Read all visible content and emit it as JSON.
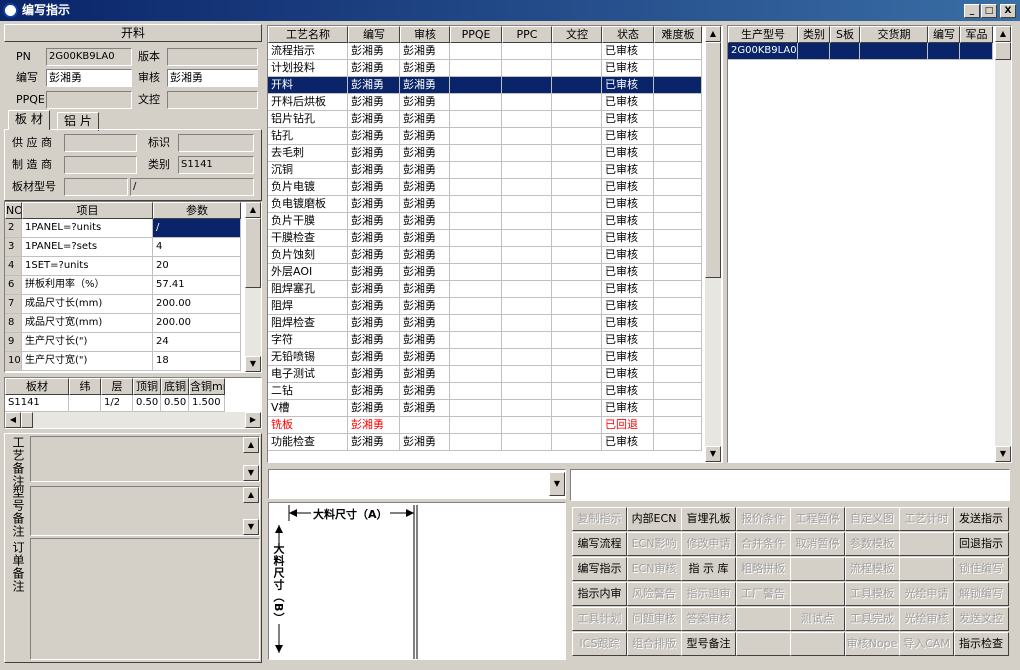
{
  "window": {
    "title": "编写指示",
    "min": "_",
    "max": "□",
    "close": "X"
  },
  "left": {
    "section_title": "开料",
    "pn_label": "PN",
    "pn_value": "2G00KB9LA0",
    "version_label": "版本",
    "version_value": "",
    "author_label": "编写",
    "author_value": "彭湘勇",
    "review_label": "审核",
    "review_value": "彭湘勇",
    "ppqe_label": "PPQE",
    "ppqe_value": "",
    "doc_label": "文控",
    "doc_value": "",
    "tabs": [
      "板 材",
      "铝 片"
    ],
    "supplier_label": "供 应 商",
    "supplier_value": "",
    "mark_label": "标识",
    "mark_value": "",
    "maker_label": "制 造 商",
    "maker_value": "",
    "category_label": "类别",
    "category_value": "S1141",
    "model_label": "板材型号",
    "model_value": "",
    "model_value2": "/",
    "param_headers": [
      "NO",
      "项目",
      "参数"
    ],
    "params": [
      {
        "no": "2",
        "item": "1PANEL=?units",
        "val": "/"
      },
      {
        "no": "3",
        "item": "1PANEL=?sets",
        "val": "4"
      },
      {
        "no": "4",
        "item": "1SET=?units",
        "val": "20"
      },
      {
        "no": "6",
        "item": "拼板利用率（%）",
        "val": "57.41"
      },
      {
        "no": "7",
        "item": "成品尺寸长(mm)",
        "val": "200.00"
      },
      {
        "no": "8",
        "item": "成品尺寸宽(mm)",
        "val": "200.00"
      },
      {
        "no": "9",
        "item": "生产尺寸长(\")",
        "val": "24"
      },
      {
        "no": "10",
        "item": "生产尺寸宽(\")",
        "val": "18"
      }
    ],
    "board_headers": [
      "板材",
      "纬",
      "层",
      "顶铜",
      "底铜",
      "含铜mm"
    ],
    "board_row": [
      "S1141",
      "",
      "1/2",
      "0.50",
      "0.50",
      "1.500"
    ],
    "notes_labels": [
      "工艺备注",
      "型号备注",
      "订单备注"
    ]
  },
  "process": {
    "headers": [
      "工艺名称",
      "编写",
      "审核",
      "PPQE",
      "PPC",
      "文控",
      "状态",
      "难度板"
    ],
    "rows": [
      [
        "流程指示",
        "彭湘勇",
        "彭湘勇",
        "",
        "",
        "",
        "已审核",
        ""
      ],
      [
        "计划投料",
        "彭湘勇",
        "彭湘勇",
        "",
        "",
        "",
        "已审核",
        ""
      ],
      [
        "开料",
        "彭湘勇",
        "彭湘勇",
        "",
        "",
        "",
        "已审核",
        ""
      ],
      [
        "开料后烘板",
        "彭湘勇",
        "彭湘勇",
        "",
        "",
        "",
        "已审核",
        ""
      ],
      [
        "铝片钻孔",
        "彭湘勇",
        "彭湘勇",
        "",
        "",
        "",
        "已审核",
        ""
      ],
      [
        "钻孔",
        "彭湘勇",
        "彭湘勇",
        "",
        "",
        "",
        "已审核",
        ""
      ],
      [
        "去毛刺",
        "彭湘勇",
        "彭湘勇",
        "",
        "",
        "",
        "已审核",
        ""
      ],
      [
        "沉铜",
        "彭湘勇",
        "彭湘勇",
        "",
        "",
        "",
        "已审核",
        ""
      ],
      [
        "负片电镀",
        "彭湘勇",
        "彭湘勇",
        "",
        "",
        "",
        "已审核",
        ""
      ],
      [
        "负电镀磨板",
        "彭湘勇",
        "彭湘勇",
        "",
        "",
        "",
        "已审核",
        ""
      ],
      [
        "负片干膜",
        "彭湘勇",
        "彭湘勇",
        "",
        "",
        "",
        "已审核",
        ""
      ],
      [
        "干膜检查",
        "彭湘勇",
        "彭湘勇",
        "",
        "",
        "",
        "已审核",
        ""
      ],
      [
        "负片蚀刻",
        "彭湘勇",
        "彭湘勇",
        "",
        "",
        "",
        "已审核",
        ""
      ],
      [
        "外层AOI",
        "彭湘勇",
        "彭湘勇",
        "",
        "",
        "",
        "已审核",
        ""
      ],
      [
        "阻焊塞孔",
        "彭湘勇",
        "彭湘勇",
        "",
        "",
        "",
        "已审核",
        ""
      ],
      [
        "阻焊",
        "彭湘勇",
        "彭湘勇",
        "",
        "",
        "",
        "已审核",
        ""
      ],
      [
        "阻焊检查",
        "彭湘勇",
        "彭湘勇",
        "",
        "",
        "",
        "已审核",
        ""
      ],
      [
        "字符",
        "彭湘勇",
        "彭湘勇",
        "",
        "",
        "",
        "已审核",
        ""
      ],
      [
        "无铅喷锡",
        "彭湘勇",
        "彭湘勇",
        "",
        "",
        "",
        "已审核",
        ""
      ],
      [
        "电子测试",
        "彭湘勇",
        "彭湘勇",
        "",
        "",
        "",
        "已审核",
        ""
      ],
      [
        "二钻",
        "彭湘勇",
        "彭湘勇",
        "",
        "",
        "",
        "已审核",
        ""
      ],
      [
        "V槽",
        "彭湘勇",
        "彭湘勇",
        "",
        "",
        "",
        "已审核",
        ""
      ],
      [
        "铣板",
        "彭湘勇",
        "",
        "",
        "",
        "",
        "已回退",
        ""
      ],
      [
        "功能检查",
        "彭湘勇",
        "彭湘勇",
        "",
        "",
        "",
        "已审核",
        ""
      ]
    ],
    "selected_index": 2,
    "returned_index": 22
  },
  "product": {
    "headers": [
      "生产型号",
      "类别",
      "S板",
      "交货期",
      "编写",
      "军品"
    ],
    "rows": [
      [
        "2G00KB9LA0",
        "",
        "",
        "",
        "",
        ""
      ]
    ]
  },
  "drawing": {
    "width_label": "大料尺寸（A）",
    "height_label": "大料尺寸（B）"
  },
  "actions": [
    [
      {
        "t": "复制指示",
        "d": true
      },
      {
        "t": "内部ECN",
        "d": false
      },
      {
        "t": "盲埋孔板",
        "d": false
      },
      {
        "t": "报价条件",
        "d": true
      },
      {
        "t": "工程暂停",
        "d": true
      },
      {
        "t": "自定义图",
        "d": true
      },
      {
        "t": "工艺计时",
        "d": true
      },
      {
        "t": "发送指示",
        "d": false
      }
    ],
    [
      {
        "t": "编写流程",
        "d": false
      },
      {
        "t": "ECN影响",
        "d": true
      },
      {
        "t": "修改申请",
        "d": true
      },
      {
        "t": "合并条件",
        "d": true
      },
      {
        "t": "取消暂停",
        "d": true
      },
      {
        "t": "参数模板",
        "d": true
      },
      {
        "t": "",
        "d": true
      },
      {
        "t": "回退指示",
        "d": false
      }
    ],
    [
      {
        "t": "编写指示",
        "d": false
      },
      {
        "t": "ECN审核",
        "d": true
      },
      {
        "t": "指 示 库",
        "d": false
      },
      {
        "t": "粗略拼板",
        "d": true
      },
      {
        "t": "",
        "d": true
      },
      {
        "t": "流程模板",
        "d": true
      },
      {
        "t": "",
        "d": true
      },
      {
        "t": "锁住编写",
        "d": true
      }
    ],
    [
      {
        "t": "指示内审",
        "d": false
      },
      {
        "t": "风险警告",
        "d": true
      },
      {
        "t": "指示退审",
        "d": true
      },
      {
        "t": "工厂警告",
        "d": true
      },
      {
        "t": "",
        "d": true
      },
      {
        "t": "工具模板",
        "d": true
      },
      {
        "t": "光绘申请",
        "d": true
      },
      {
        "t": "解锁编写",
        "d": true
      }
    ],
    [
      {
        "t": "工具计划",
        "d": true
      },
      {
        "t": "问题审核",
        "d": true
      },
      {
        "t": "答案审核",
        "d": true
      },
      {
        "t": "",
        "d": true
      },
      {
        "t": "测试点",
        "d": true
      },
      {
        "t": "工具完成",
        "d": true
      },
      {
        "t": "光绘审核",
        "d": true
      },
      {
        "t": "发送文控",
        "d": true
      }
    ],
    [
      {
        "t": "ICS跟踪",
        "d": true
      },
      {
        "t": "组合排版",
        "d": true
      },
      {
        "t": "型号备注",
        "d": false
      },
      {
        "t": "",
        "d": true
      },
      {
        "t": "",
        "d": true
      },
      {
        "t": "审核Nope",
        "d": true
      },
      {
        "t": "导入CAM",
        "d": true
      },
      {
        "t": "指示检查",
        "d": false
      }
    ]
  ],
  "colors": {
    "selection": "#0a246a",
    "returned": "#ff0000"
  }
}
